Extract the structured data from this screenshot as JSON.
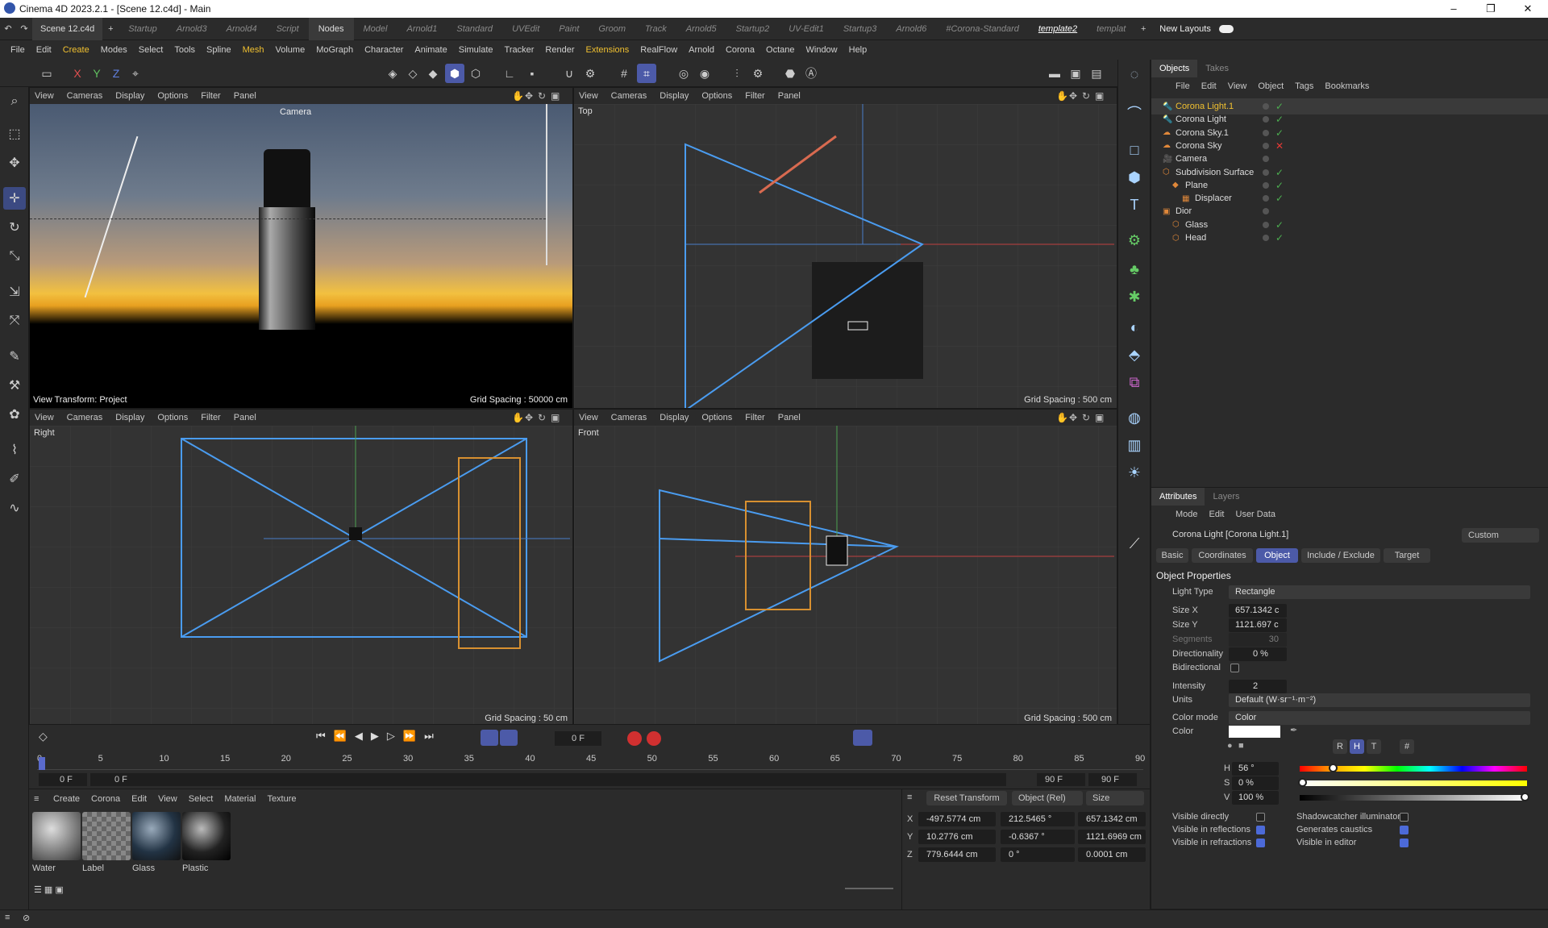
{
  "window": {
    "title": "Cinema 4D 2023.2.1 - [Scene 12.c4d] - Main",
    "min": "–",
    "max": "❐",
    "close": "✕"
  },
  "doc_tabs": [
    "Scene 12.c4d"
  ],
  "layout_tabs": [
    "Startup",
    "Arnold3",
    "Arnold4",
    "Script",
    "Nodes",
    "Model",
    "Arnold1",
    "Standard",
    "UVEdit",
    "Paint",
    "Groom",
    "Track",
    "Arnold5",
    "Startup2",
    "UV-Edit1",
    "Startup3",
    "Arnold6",
    "#Corona-Standard",
    "template2",
    "templat"
  ],
  "new_layouts": "New Layouts",
  "menus": [
    "File",
    "Edit",
    "Create",
    "Modes",
    "Select",
    "Tools",
    "Spline",
    "Mesh",
    "Volume",
    "MoGraph",
    "Character",
    "Animate",
    "Simulate",
    "Tracker",
    "Render",
    "Extensions",
    "RealFlow",
    "Arnold",
    "Corona",
    "Octane",
    "Window",
    "Help"
  ],
  "axis": {
    "x": "X",
    "y": "Y",
    "z": "Z"
  },
  "viewport_menu": [
    "View",
    "Cameras",
    "Display",
    "Options",
    "Filter",
    "Panel"
  ],
  "viewports": {
    "persp": {
      "camera_label": "Camera",
      "transform": "View Transform: Project",
      "grid": "Grid Spacing : 50000 cm"
    },
    "top": {
      "label": "Top",
      "grid": "Grid Spacing : 500 cm"
    },
    "right": {
      "label": "Right",
      "grid": "Grid Spacing : 50 cm"
    },
    "front": {
      "label": "Front",
      "grid": "Grid Spacing : 500 cm"
    }
  },
  "objects": {
    "tabs": [
      "Objects",
      "Takes"
    ],
    "menu": [
      "File",
      "Edit",
      "View",
      "Object",
      "Tags",
      "Bookmarks"
    ],
    "items": [
      {
        "name": "Corona Light.1",
        "selected": true
      },
      {
        "name": "Corona Light"
      },
      {
        "name": "Corona Sky.1"
      },
      {
        "name": "Corona Sky"
      },
      {
        "name": "Camera"
      },
      {
        "name": "Subdivision Surface"
      },
      {
        "name": "Plane"
      },
      {
        "name": "Displacer"
      },
      {
        "name": "Dior"
      },
      {
        "name": "Glass"
      },
      {
        "name": "Head"
      }
    ]
  },
  "attributes": {
    "tabs": [
      "Attributes",
      "Layers"
    ],
    "menu": [
      "Mode",
      "Edit",
      "User Data"
    ],
    "object_title": "Corona Light [Corona Light.1]",
    "preset": "Custom",
    "sub_tabs": [
      "Basic",
      "Coordinates",
      "Object",
      "Include / Exclude",
      "Target"
    ],
    "section": "Object Properties",
    "light_type_label": "Light Type",
    "light_type": "Rectangle",
    "size_x_label": "Size X",
    "size_x": "657.1342 c",
    "size_y_label": "Size Y",
    "size_y": "1121.697 c",
    "segments_label": "Segments",
    "segments": "30",
    "directionality_label": "Directionality",
    "directionality": "0 %",
    "bidirectional_label": "Bidirectional",
    "intensity_label": "Intensity",
    "intensity": "2",
    "units_label": "Units",
    "units": "Default (W·sr⁻¹·m⁻²)",
    "color_mode_label": "Color mode",
    "color_mode": "Color",
    "color_label": "Color",
    "color_buttons": [
      "R",
      "H",
      "T",
      "#"
    ],
    "h_label": "H",
    "h": "56 °",
    "s_label": "S",
    "s": "0 %",
    "v_label": "V",
    "v": "100 %",
    "visible_directly": "Visible directly",
    "visible_reflections": "Visible in reflections",
    "visible_refractions": "Visible in refractions",
    "shadowcatcher": "Shadowcatcher illuminator",
    "generates_caustics": "Generates caustics",
    "visible_editor": "Visible in editor"
  },
  "timeline": {
    "frame": "0 F",
    "start": "0 F",
    "start2": "0 F",
    "end": "90 F",
    "end2": "90 F",
    "ticks": [
      "0",
      "5",
      "10",
      "15",
      "20",
      "25",
      "30",
      "35",
      "40",
      "45",
      "50",
      "55",
      "60",
      "65",
      "70",
      "75",
      "80",
      "85",
      "90"
    ]
  },
  "materials": {
    "menu": [
      "Create",
      "Corona",
      "Edit",
      "View",
      "Select",
      "Material",
      "Texture"
    ],
    "items": [
      "Water",
      "Label",
      "Glass",
      "Plastic"
    ]
  },
  "coords": {
    "reset": "Reset Transform",
    "mode": "Object (Rel)",
    "size": "Size",
    "rows": [
      {
        "axis": "X",
        "pos": "-497.5774 cm",
        "rot": "212.5465 °",
        "size": "657.1342 cm"
      },
      {
        "axis": "Y",
        "pos": "10.2776 cm",
        "rot": "-0.6367 °",
        "size": "1121.6969 cm"
      },
      {
        "axis": "Z",
        "pos": "779.6444 cm",
        "rot": "0 °",
        "size": "0.0001 cm"
      }
    ]
  }
}
